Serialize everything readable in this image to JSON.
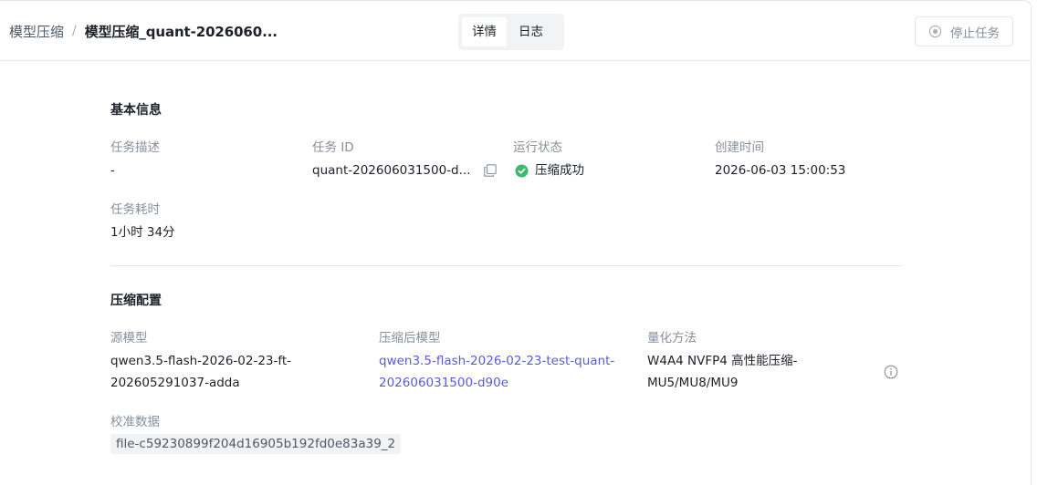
{
  "breadcrumb": {
    "parent": "模型压缩",
    "separator": "/",
    "current": "模型压缩_quant-2026060..."
  },
  "tabs": [
    {
      "label": "详情",
      "active": true
    },
    {
      "label": "日志",
      "active": false
    }
  ],
  "actions": {
    "stop_label": "停止任务"
  },
  "basic_info": {
    "title": "基本信息",
    "fields": {
      "description": {
        "label": "任务描述",
        "value": "-"
      },
      "task_id": {
        "label": "任务 ID",
        "value": "quant-202606031500-d..."
      },
      "status": {
        "label": "运行状态",
        "value": "压缩成功",
        "color": "#3fb96f"
      },
      "created_at": {
        "label": "创建时间",
        "value": "2026-06-03 15:00:53"
      },
      "duration": {
        "label": "任务耗时",
        "value": "1小时 34分"
      }
    }
  },
  "compress_config": {
    "title": "压缩配置",
    "fields": {
      "source_model": {
        "label": "源模型",
        "line1": "qwen3.5-flash-2026-02-23-ft-",
        "line2": "202605291037-adda"
      },
      "output_model": {
        "label": "压缩后模型",
        "line1": "qwen3.5-flash-2026-02-23-test-quant-",
        "line2": "202606031500-d90e",
        "color": "#5b5bd6"
      },
      "quant_method": {
        "label": "量化方法",
        "line1": "W4A4 NVFP4 高性能压缩-",
        "line2": "MU5/MU8/MU9"
      },
      "calib_data": {
        "label": "校准数据",
        "value": "file-c59230899f204d16905b192fd0e83a39_2"
      }
    }
  },
  "icons": {
    "stop": "stop-circle-icon",
    "copy": "copy-icon",
    "status": "check-circle-icon",
    "info": "info-icon"
  }
}
